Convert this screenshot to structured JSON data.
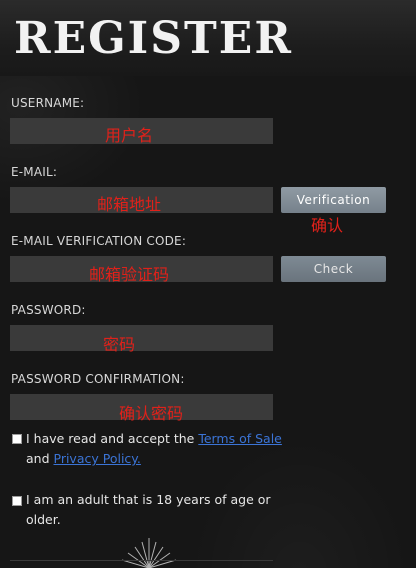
{
  "header": {
    "title": "REGISTER"
  },
  "form": {
    "username": {
      "label": "USERNAME:",
      "value": "用户名"
    },
    "email": {
      "label": "E-MAIL:",
      "value": "邮箱地址"
    },
    "verification_button": "Verification",
    "verification_note": "确认",
    "email_code": {
      "label": "E-MAIL VERIFICATION CODE:",
      "value": "邮箱验证码"
    },
    "check_button": "Check",
    "password": {
      "label": "PASSWORD:",
      "value": "密码"
    },
    "password_confirm": {
      "label": "PASSWORD CONFIRMATION:",
      "value": "确认密码"
    }
  },
  "agreements": {
    "terms_prefix": "I have read and accept the ",
    "terms_link": "Terms of Sale",
    "and_text": "and ",
    "privacy_link": "Privacy Policy.",
    "adult_line1": "I am an adult that is 18 years of age or",
    "adult_line2": "older."
  },
  "colors": {
    "accent_red": "#e0211a",
    "link_blue": "#3b74d6",
    "button_gray": "#8f9aa3"
  }
}
